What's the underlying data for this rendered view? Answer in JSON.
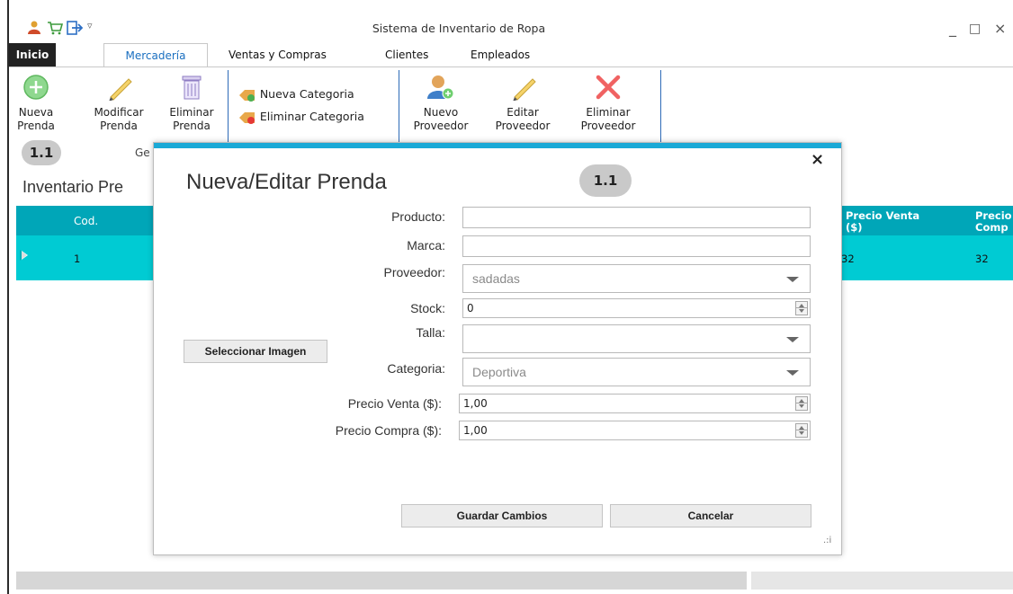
{
  "window": {
    "title": "Sistema de Inventario de Ropa",
    "min": "_",
    "max": "□",
    "close": "×"
  },
  "tabs": [
    "Inicio",
    "Mercadería",
    "Ventas y Compras",
    "Clientes",
    "Empleados"
  ],
  "ribbon": {
    "nueva_prenda": [
      "Nueva",
      "Prenda"
    ],
    "modificar_prenda": [
      "Modificar",
      "Prenda"
    ],
    "eliminar_prenda": [
      "Eliminar",
      "Prenda"
    ],
    "nueva_categoria": "Nueva Categoria",
    "eliminar_categoria": "Eliminar Categoria",
    "nuevo_proveedor": [
      "Nuevo",
      "Proveedor"
    ],
    "editar_proveedor": [
      "Editar",
      "Proveedor"
    ],
    "eliminar_proveedor": [
      "Eliminar",
      "Proveedor"
    ],
    "group_label": "Ge",
    "badge": "1.1"
  },
  "main": {
    "title": "Inventario Pre",
    "columns": [
      "Cod.",
      "Precio Venta\n($)",
      "Precio\nComp"
    ],
    "row": {
      "cod": "1",
      "precio_venta": "32",
      "precio_compra": "32"
    }
  },
  "dialog": {
    "title": "Nueva/Editar Prenda",
    "badge": "1.1",
    "close": "×",
    "labels": {
      "producto": "Producto:",
      "marca": "Marca:",
      "proveedor": "Proveedor:",
      "stock": "Stock:",
      "talla": "Talla:",
      "categoria": "Categoria:",
      "precio_venta": "Precio Venta ($):",
      "precio_compra": "Precio Compra ($):"
    },
    "values": {
      "producto": "",
      "marca": "",
      "proveedor": "sadadas",
      "stock": "0",
      "talla": "",
      "categoria": "Deportiva",
      "precio_venta": "1,00",
      "precio_compra": "1,00"
    },
    "buttons": {
      "seleccionar_imagen": "Seleccionar Imagen",
      "guardar": "Guardar Cambios",
      "cancelar": "Cancelar"
    },
    "grip": ".:i"
  },
  "colors": {
    "accent": "#1aa9d6",
    "grid_header": "#00a6b8",
    "grid_row": "#00cbd3",
    "ribbon_separator": "#2e6bb8"
  }
}
